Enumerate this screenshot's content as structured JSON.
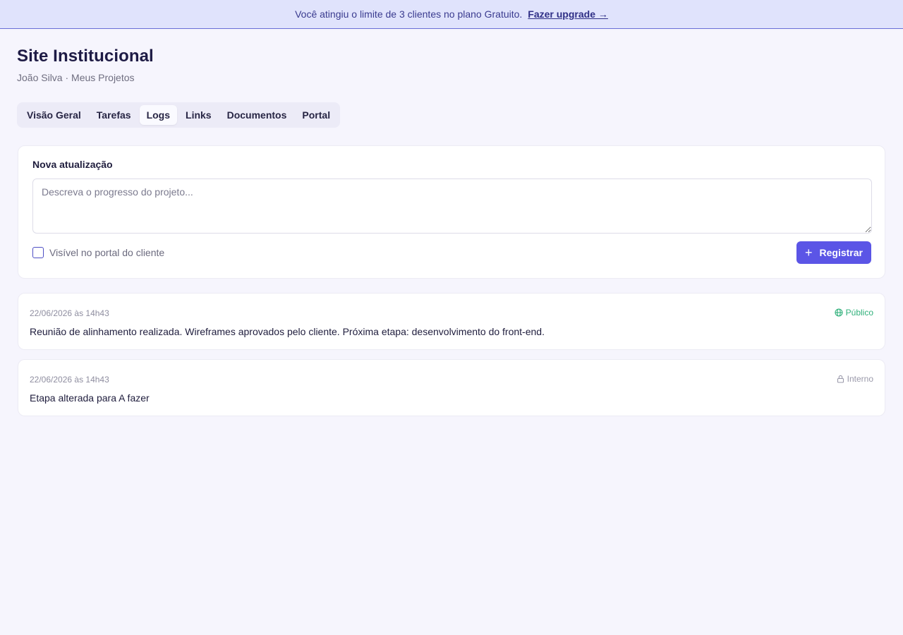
{
  "banner": {
    "message": "Você atingiu o limite de 3 clientes no plano Gratuito.",
    "upgrade_link": "Fazer upgrade →"
  },
  "header": {
    "title": "Site Institucional",
    "breadcrumb": "João Silva · Meus Projetos"
  },
  "tabs": [
    {
      "label": "Visão Geral"
    },
    {
      "label": "Tarefas"
    },
    {
      "label": "Logs",
      "active": true
    },
    {
      "label": "Links"
    },
    {
      "label": "Documentos"
    },
    {
      "label": "Portal"
    }
  ],
  "composer": {
    "label": "Nova atualização",
    "placeholder": "Descreva o progresso do projeto...",
    "value": "",
    "visible_label": "Visível no portal do cliente",
    "visible_checked": false,
    "submit_icon": "plus-icon",
    "submit_label": "Registrar"
  },
  "logs": [
    {
      "timestamp": "22/06/2026 às 14h43",
      "text": "Reunião de alinhamento realizada. Wireframes aprovados pelo cliente. Próxima etapa: desenvolvimento do front-end.",
      "visibility": "Público",
      "icon": "globe-icon"
    },
    {
      "timestamp": "22/06/2026 às 14h43",
      "text": "Etapa alterada para A fazer",
      "visibility": "Interno",
      "icon": "lock-icon"
    }
  ],
  "colors": {
    "accent": "#5b55e6",
    "banner_bg": "#e0e3fc",
    "public": "#2fb07a",
    "internal": "#9a99aa"
  }
}
